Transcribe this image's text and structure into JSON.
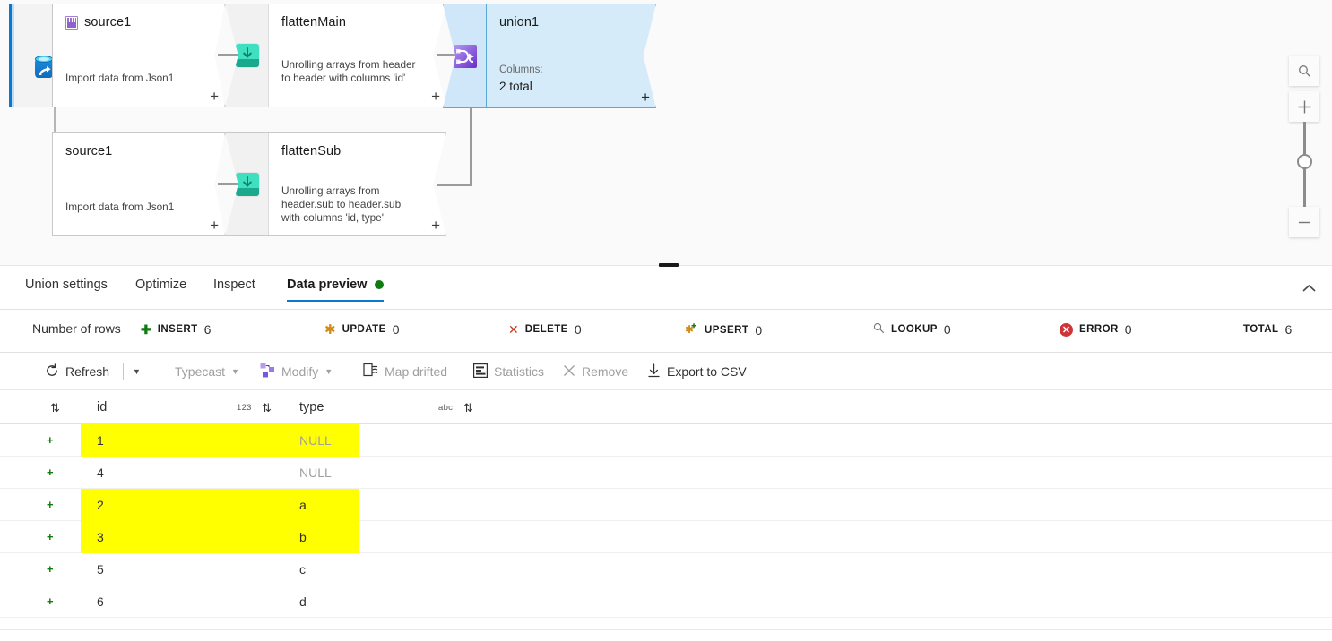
{
  "canvas": {
    "source_rail_icon": "data-store-icon",
    "nodes": [
      {
        "name": "source1",
        "icon": "json-file-icon",
        "description": "Import data from Json1",
        "plus": "+"
      },
      {
        "name": "flattenMain",
        "icon": "flatten-icon",
        "description": "Unrolling arrays from header to header with columns 'id'",
        "plus": "+"
      },
      {
        "name": "union1",
        "icon": "union-icon",
        "columns_label": "Columns:",
        "columns_value": "2 total",
        "plus": "+"
      },
      {
        "name": "source1",
        "icon": "json-file-icon",
        "description": "Import data from Json1",
        "plus": "+"
      },
      {
        "name": "flattenSub",
        "icon": "flatten-icon",
        "description": "Unrolling arrays from header.sub to header.sub with columns 'id, type'",
        "plus": "+"
      }
    ],
    "zoom_controls": {
      "fit_icon": "magnifier-icon",
      "zoom_in": "+",
      "zoom_out": "—"
    }
  },
  "tabs": {
    "items": [
      {
        "label": "Union settings",
        "active": false
      },
      {
        "label": "Optimize",
        "active": false
      },
      {
        "label": "Inspect",
        "active": false
      },
      {
        "label": "Data preview",
        "active": true,
        "status_dot": "#107c10"
      }
    ],
    "collapse_icon": "chevron-up-icon"
  },
  "stats": {
    "number_of_rows_label": "Number of rows",
    "items": [
      {
        "label": "INSERT",
        "value": "6",
        "icon": "plus-icon",
        "color": "#107c10"
      },
      {
        "label": "UPDATE",
        "value": "0",
        "icon": "asterisk-icon",
        "color": "#d18b19"
      },
      {
        "label": "DELETE",
        "value": "0",
        "icon": "x-icon",
        "color": "#c23b22"
      },
      {
        "label": "UPSERT",
        "value": "0",
        "icon": "upsert-icon",
        "color": "#d18b19"
      },
      {
        "label": "LOOKUP",
        "value": "0",
        "icon": "magnifier-icon",
        "color": "#767676"
      },
      {
        "label": "ERROR",
        "value": "0",
        "icon": "error-circle-icon",
        "color": "#d13438"
      },
      {
        "label": "TOTAL",
        "value": "6",
        "icon": "none",
        "color": "#323130"
      }
    ]
  },
  "toolbar": {
    "refresh": {
      "label": "Refresh",
      "icon": "refresh-icon",
      "disabled": false,
      "has_chevron": true
    },
    "typecast": {
      "label": "Typecast",
      "icon": "none",
      "disabled": true,
      "has_chevron": true
    },
    "modify": {
      "label": "Modify",
      "icon": "modify-icon",
      "disabled": true,
      "has_chevron": true
    },
    "map_drifted": {
      "label": "Map drifted",
      "icon": "map-drifted-icon",
      "disabled": true
    },
    "statistics": {
      "label": "Statistics",
      "icon": "statistics-icon",
      "disabled": true
    },
    "remove": {
      "label": "Remove",
      "icon": "close-icon",
      "disabled": true
    },
    "export_csv": {
      "label": "Export to CSV",
      "icon": "download-icon",
      "disabled": false
    }
  },
  "grid": {
    "columns": [
      {
        "name": "id",
        "type_badge": "123"
      },
      {
        "name": "type",
        "type_badge": "abc"
      }
    ],
    "rows": [
      {
        "mark": "+",
        "id": "1",
        "type": "NULL",
        "type_is_null": true,
        "highlighted": true
      },
      {
        "mark": "+",
        "id": "4",
        "type": "NULL",
        "type_is_null": true,
        "highlighted": false
      },
      {
        "mark": "+",
        "id": "2",
        "type": "a",
        "type_is_null": false,
        "highlighted": true
      },
      {
        "mark": "+",
        "id": "3",
        "type": "b",
        "type_is_null": false,
        "highlighted": true
      },
      {
        "mark": "+",
        "id": "5",
        "type": "c",
        "type_is_null": false,
        "highlighted": false
      },
      {
        "mark": "+",
        "id": "6",
        "type": "d",
        "type_is_null": false,
        "highlighted": false
      }
    ],
    "highlight_color": "#ffff00"
  }
}
